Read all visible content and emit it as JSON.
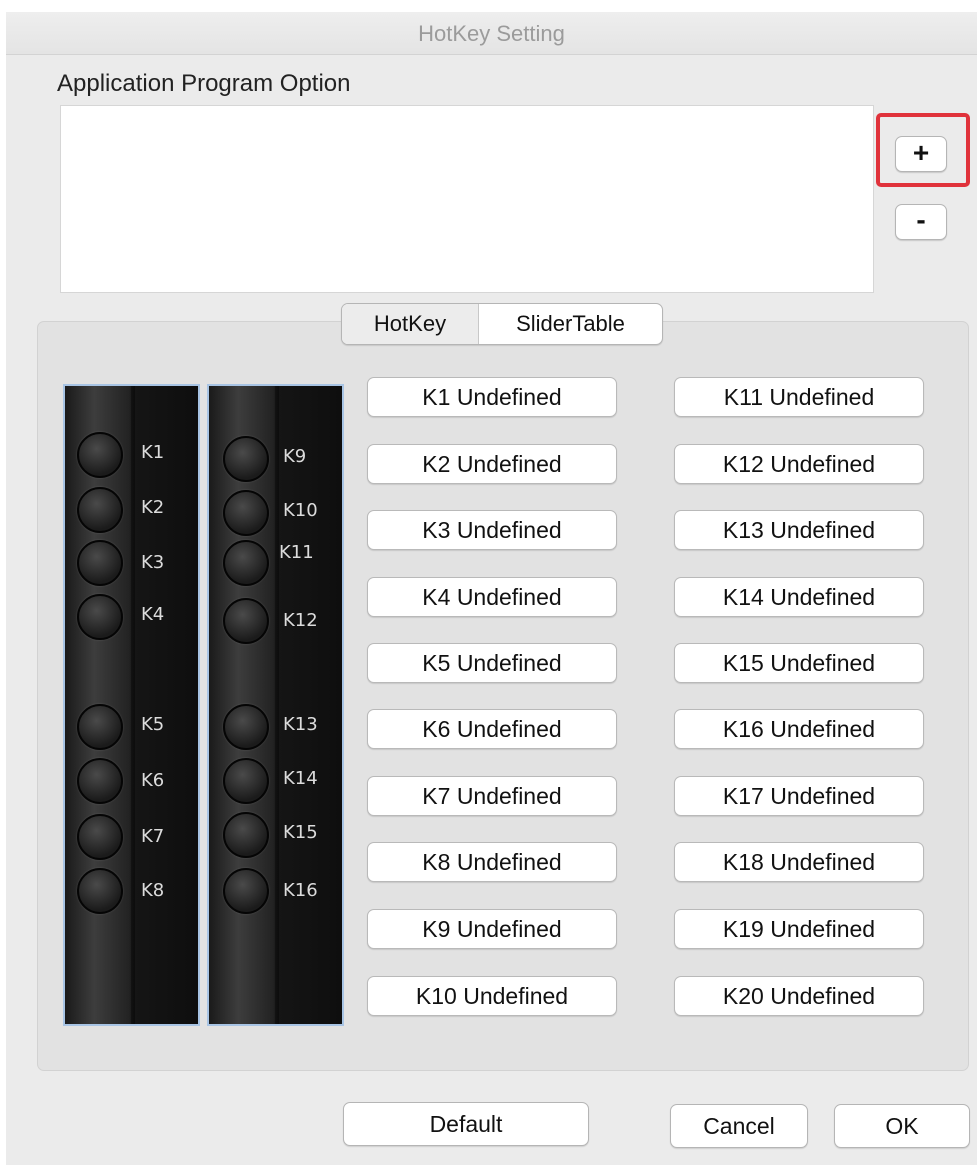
{
  "window": {
    "title": "HotKey Setting"
  },
  "app_section": {
    "label": "Application Program Option",
    "add_label": "+",
    "remove_label": "-"
  },
  "tabs": [
    {
      "label": "HotKey",
      "selected": true
    },
    {
      "label": "SliderTable",
      "selected": false
    }
  ],
  "device_keys": {
    "left": [
      "K1",
      "K2",
      "K3",
      "K4",
      "K5",
      "K6",
      "K7",
      "K8"
    ],
    "right": [
      "K9",
      "K10",
      "K11",
      "K12",
      "K13",
      "K14",
      "K15",
      "K16"
    ]
  },
  "hotkeys": {
    "left": [
      "K1 Undefined",
      "K2 Undefined",
      "K3 Undefined",
      "K4 Undefined",
      "K5 Undefined",
      "K6 Undefined",
      "K7 Undefined",
      "K8 Undefined",
      "K9 Undefined",
      "K10 Undefined"
    ],
    "right": [
      "K11 Undefined",
      "K12 Undefined",
      "K13 Undefined",
      "K14 Undefined",
      "K15 Undefined",
      "K16 Undefined",
      "K17 Undefined",
      "K18 Undefined",
      "K19 Undefined",
      "K20 Undefined"
    ]
  },
  "footer": {
    "default_label": "Default",
    "cancel_label": "Cancel",
    "ok_label": "OK"
  },
  "colors": {
    "highlight": "#e0323b",
    "device_border": "#a8c4e4"
  }
}
